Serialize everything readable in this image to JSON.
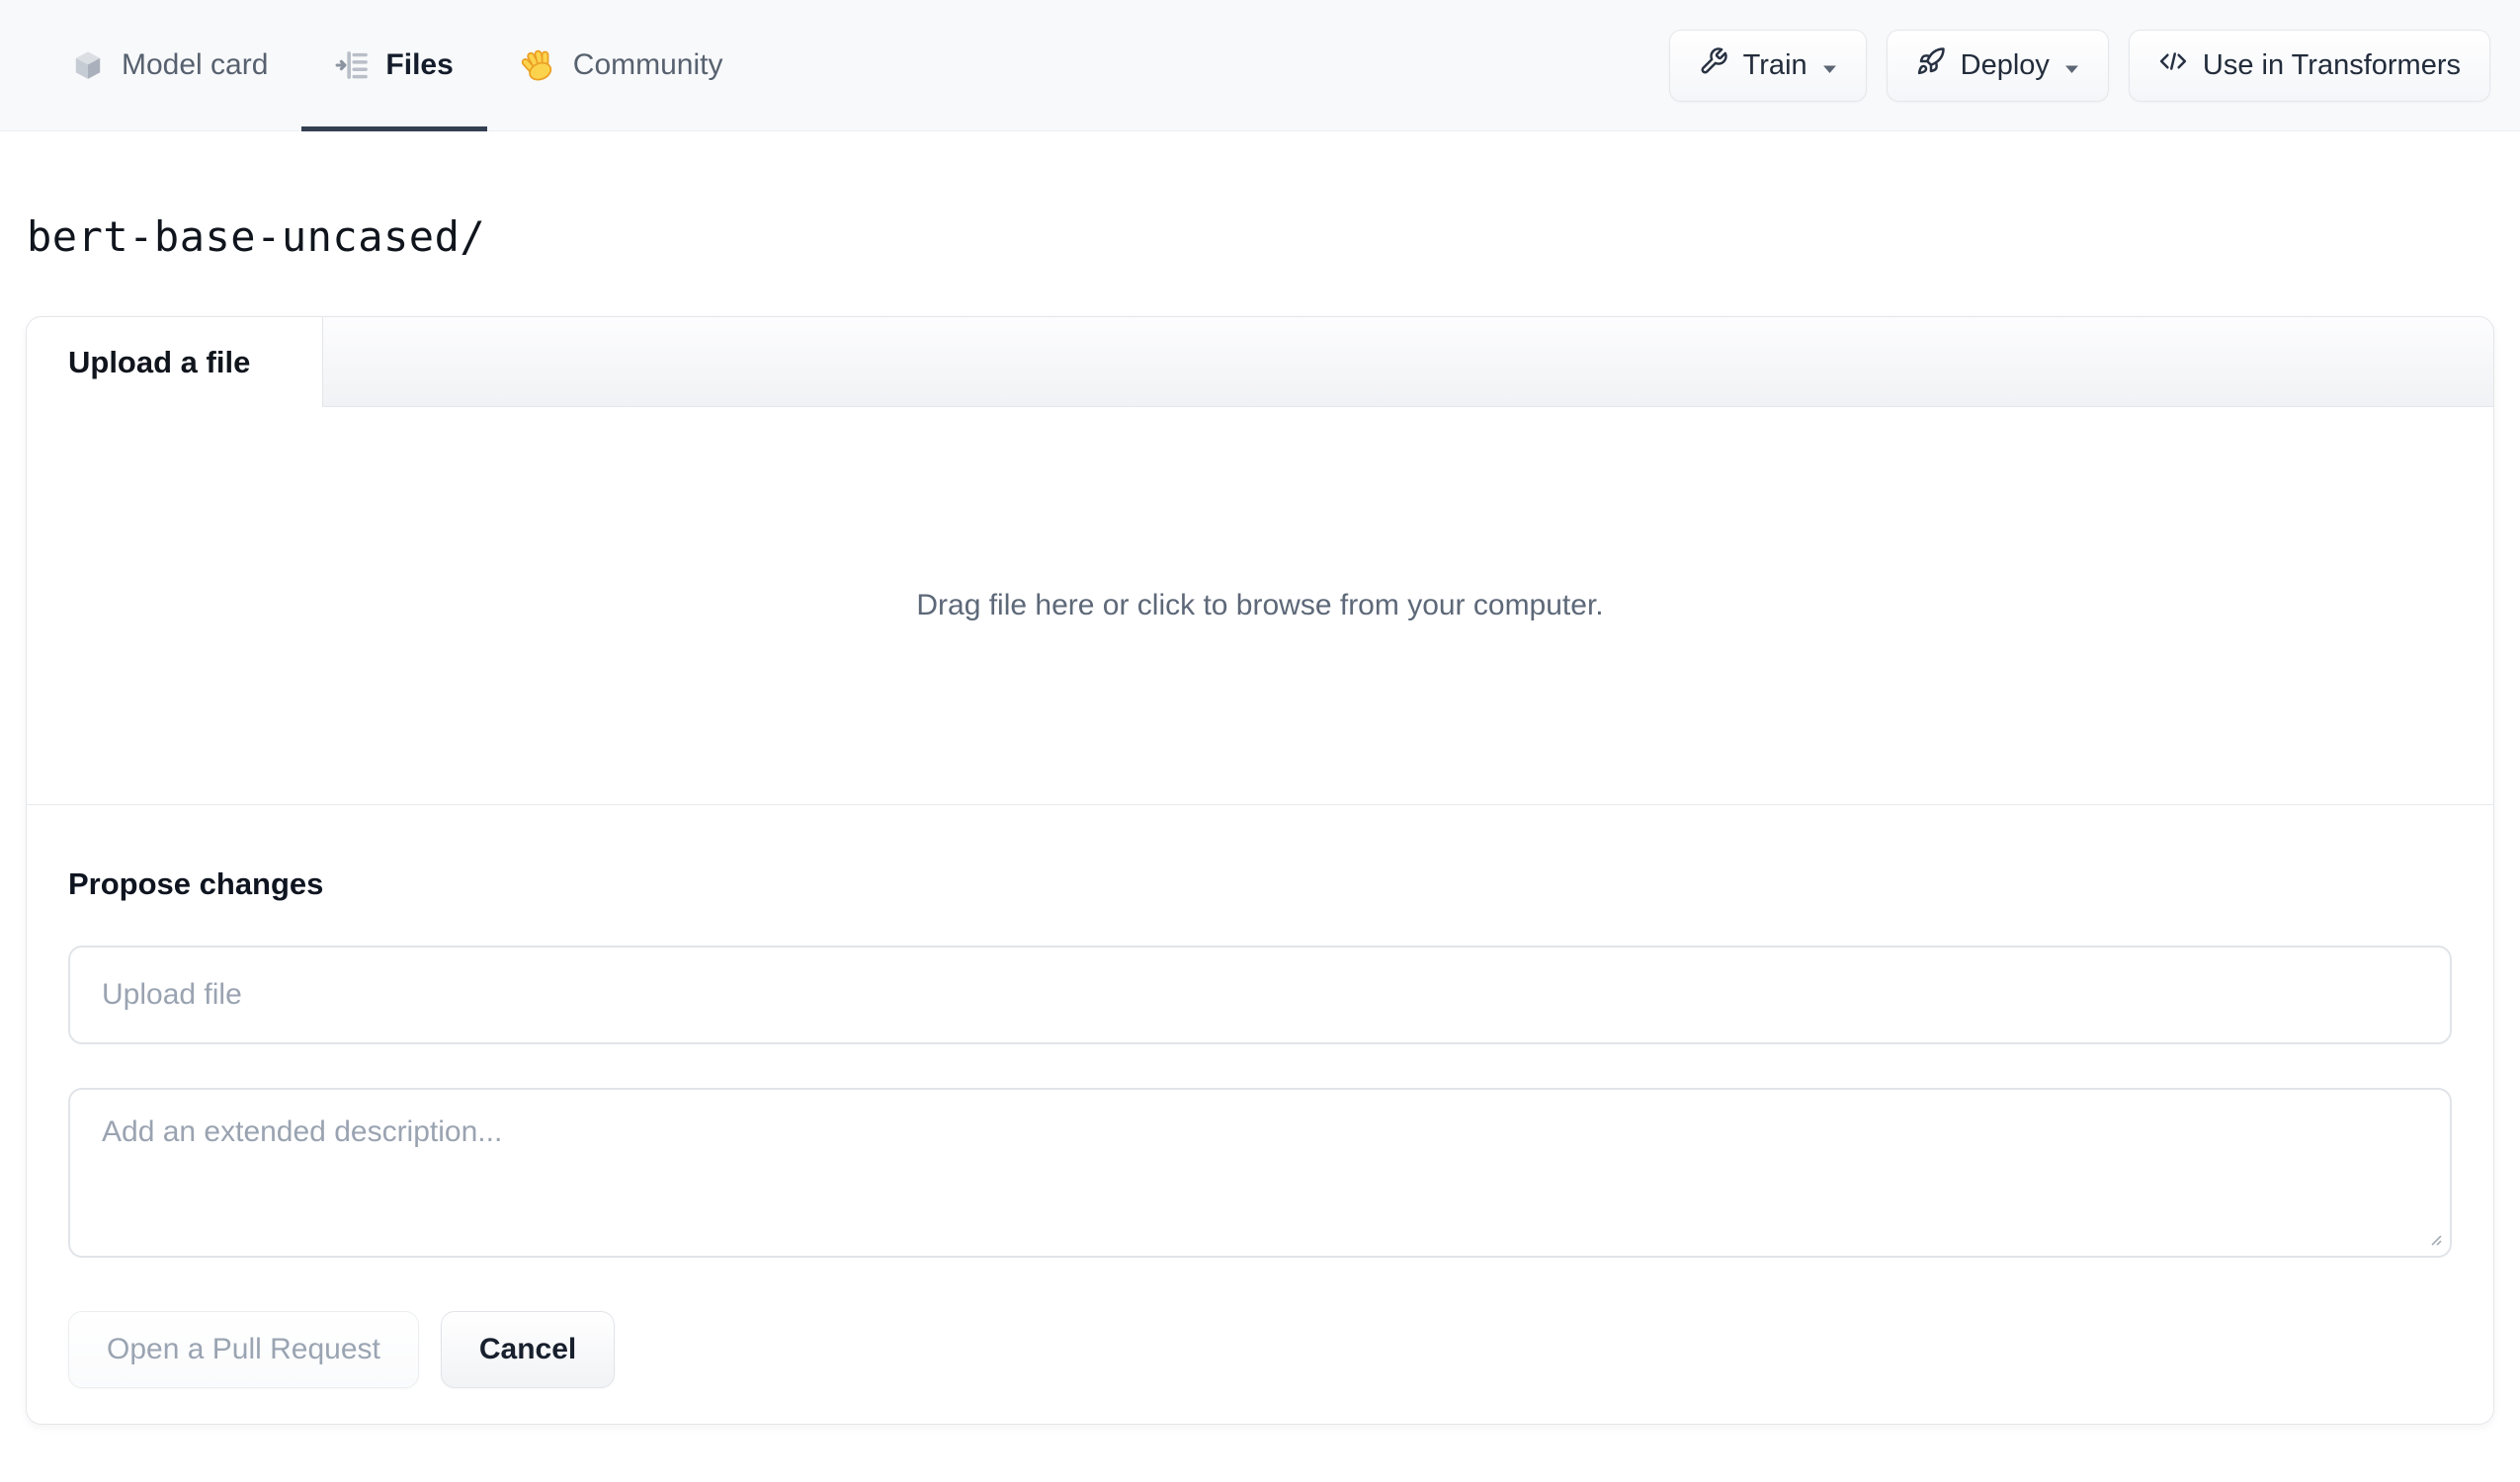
{
  "nav": {
    "tabs": [
      {
        "label": "Model card",
        "icon": "cube-icon",
        "active": false
      },
      {
        "label": "Files",
        "icon": "files-list-icon",
        "active": true
      },
      {
        "label": "Community",
        "icon": "waving-hand-icon",
        "active": false
      }
    ],
    "actions": [
      {
        "label": "Train",
        "icon": "wrench-icon",
        "has_caret": true
      },
      {
        "label": "Deploy",
        "icon": "rocket-icon",
        "has_caret": true
      },
      {
        "label": "Use in Transformers",
        "icon": "code-brackets-icon",
        "has_caret": false
      }
    ]
  },
  "breadcrumb": {
    "path": "bert-base-uncased/"
  },
  "panel": {
    "tab_label": "Upload a file",
    "dropzone_text": "Drag file here or click to browse from your computer.",
    "propose": {
      "heading": "Propose changes",
      "file_placeholder": "Upload file",
      "file_value": "",
      "description_placeholder": "Add an extended description...",
      "description_value": "",
      "submit_label": "Open a Pull Request",
      "submit_state": "disabled",
      "cancel_label": "Cancel"
    }
  },
  "icons": {
    "cube": "3d-cube glyph",
    "files_list": "arrow-into-list glyph",
    "waving_hand": "waving-hand glyph",
    "wrench": "wrench glyph",
    "rocket": "rocket glyph",
    "code_brackets": "</> glyph",
    "caret": "dropdown triangle",
    "resize_grip": "diagonal drag lines"
  },
  "colors": {
    "nav_bg": "#f8f9fb",
    "active_tab_underline": "#344051",
    "tab_text": "#57616f",
    "active_tab_text": "#141c2b",
    "border": "#e4e6ea",
    "muted_text": "#5d6878",
    "placeholder_text": "#9aa3b1",
    "disabled_text": "#9aa4b2",
    "hand_yellow": "#fcd34d",
    "hand_orange": "#eb9f23"
  }
}
